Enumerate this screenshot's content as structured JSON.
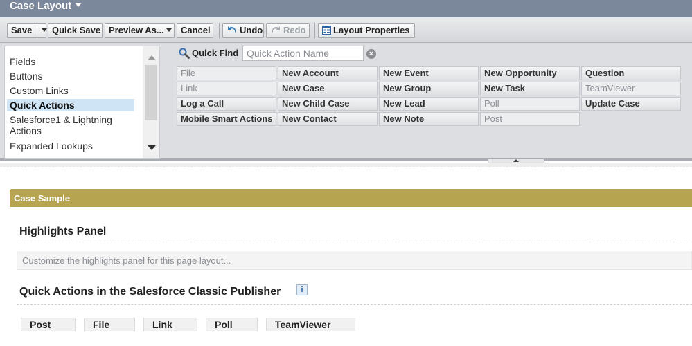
{
  "header": {
    "title": "Case Layout"
  },
  "toolbar": {
    "save": "Save",
    "quick_save": "Quick Save",
    "preview_as": "Preview As...",
    "cancel": "Cancel",
    "undo": "Undo",
    "redo": "Redo",
    "layout_properties": "Layout Properties"
  },
  "palette": {
    "categories": [
      "Fields",
      "Buttons",
      "Custom Links",
      "Quick Actions",
      "Salesforce1 & Lightning Actions",
      "Expanded Lookups"
    ],
    "selected_category": "Quick Actions",
    "quick_find": {
      "label": "Quick Find",
      "placeholder": "Quick Action Name",
      "value": ""
    },
    "actions": [
      {
        "label": "File",
        "in_use": true
      },
      {
        "label": "Link",
        "in_use": true
      },
      {
        "label": "Log a Call",
        "in_use": false
      },
      {
        "label": "Mobile Smart Actions",
        "in_use": false
      },
      {
        "label": "New Account",
        "in_use": false
      },
      {
        "label": "New Case",
        "in_use": false
      },
      {
        "label": "New Child Case",
        "in_use": false
      },
      {
        "label": "New Contact",
        "in_use": false
      },
      {
        "label": "New Event",
        "in_use": false
      },
      {
        "label": "New Group",
        "in_use": false
      },
      {
        "label": "New Lead",
        "in_use": false
      },
      {
        "label": "New Note",
        "in_use": false
      },
      {
        "label": "New Opportunity",
        "in_use": false
      },
      {
        "label": "New Task",
        "in_use": false
      },
      {
        "label": "Poll",
        "in_use": true
      },
      {
        "label": "Post",
        "in_use": true
      },
      {
        "label": "Question",
        "in_use": false
      },
      {
        "label": "TeamViewer",
        "in_use": true
      },
      {
        "label": "Update Case",
        "in_use": false
      }
    ]
  },
  "canvas": {
    "sample_title": "Case Sample",
    "highlights_title": "Highlights Panel",
    "highlights_hint": "Customize the highlights panel for this page layout...",
    "publisher_title": "Quick Actions in the Salesforce Classic Publisher",
    "publisher_actions": [
      "Post",
      "File",
      "Link",
      "Poll",
      "TeamViewer"
    ]
  },
  "colors": {
    "title_bar": "#7b879b",
    "section_header": "#b7a450",
    "selected_item": "#cfe4f5"
  }
}
